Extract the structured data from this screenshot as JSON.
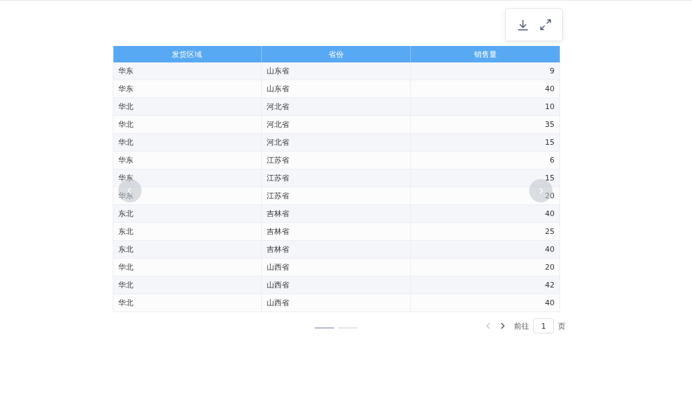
{
  "table": {
    "columns": [
      "发货区域",
      "省份",
      "销售量"
    ],
    "rows": [
      [
        "华东",
        "山东省",
        "9"
      ],
      [
        "华东",
        "山东省",
        "40"
      ],
      [
        "华北",
        "河北省",
        "10"
      ],
      [
        "华北",
        "河北省",
        "35"
      ],
      [
        "华北",
        "河北省",
        "15"
      ],
      [
        "华东",
        "江苏省",
        "6"
      ],
      [
        "华东",
        "江苏省",
        "15"
      ],
      [
        "华东",
        "江苏省",
        "20"
      ],
      [
        "东北",
        "吉林省",
        "40"
      ],
      [
        "东北",
        "吉林省",
        "25"
      ],
      [
        "东北",
        "吉林省",
        "40"
      ],
      [
        "华北",
        "山西省",
        "20"
      ],
      [
        "华北",
        "山西省",
        "42"
      ],
      [
        "华北",
        "山西省",
        "40"
      ]
    ]
  },
  "carousel": {
    "pages": [
      {
        "selected": true
      },
      {
        "selected": false
      }
    ]
  },
  "pagination": {
    "prev_disabled": true,
    "next_disabled": false,
    "goto_label": "前往",
    "page": "1",
    "page_suffix": "页"
  }
}
